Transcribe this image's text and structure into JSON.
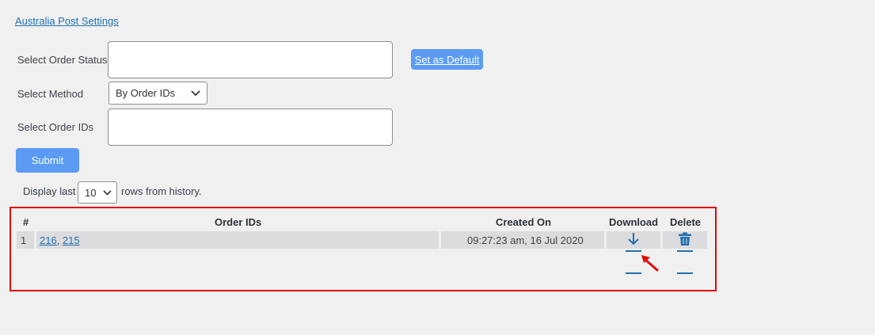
{
  "settings_link": "Australia Post Settings",
  "form": {
    "order_status_label": "Select Order Status",
    "order_status_value": "",
    "set_default_label": "Set as Default",
    "method_label": "Select Method",
    "method_value": "By Order IDs",
    "order_ids_label": "Select Order IDs",
    "order_ids_value": "",
    "submit_label": "Submit"
  },
  "history": {
    "prefix": "Display last",
    "rows_value": "10",
    "suffix": "rows from history."
  },
  "table": {
    "headers": {
      "num": "#",
      "order_ids": "Order IDs",
      "created_on": "Created On",
      "download": "Download",
      "delete": "Delete"
    },
    "rows": [
      {
        "num": "1",
        "order_ids": [
          "216",
          "215"
        ],
        "separator": ",",
        "created_on": "09:27:23 am, 16 Jul 2020"
      }
    ]
  },
  "icons": {
    "download": "download-arrow-icon",
    "delete": "trash-icon",
    "annotation": "red-arrow-icon",
    "dropdown": "chevron-down-icon"
  },
  "colors": {
    "accent": "#2271b1",
    "button": "#5b9bf3",
    "highlight_border": "#e00a0a",
    "row_bg": "#dcdcde"
  }
}
